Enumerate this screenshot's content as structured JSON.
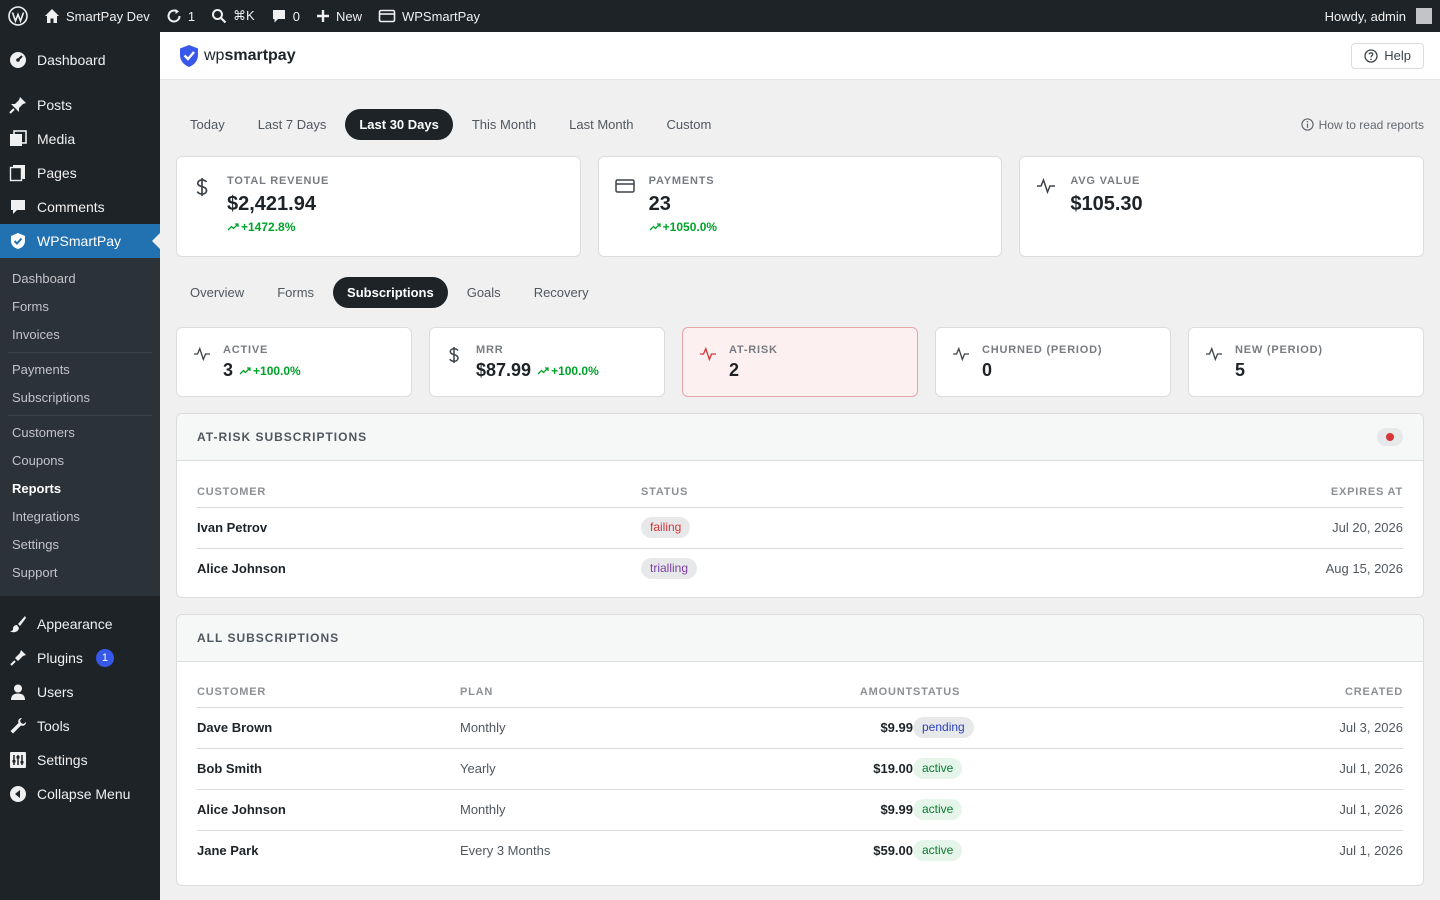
{
  "admin_bar": {
    "site_name": "SmartPay Dev",
    "updates_count": "1",
    "search_shortcut": "⌘K",
    "comments_count": "0",
    "new_label": "New",
    "plugin_label": "WPSmartPay",
    "greeting": "Howdy, admin"
  },
  "sidebar": {
    "top_items": [
      {
        "label": "Dashboard",
        "icon": "dashboard-icon"
      }
    ],
    "content_items": [
      {
        "label": "Posts",
        "icon": "pin-icon"
      },
      {
        "label": "Media",
        "icon": "media-icon"
      },
      {
        "label": "Pages",
        "icon": "pages-icon"
      },
      {
        "label": "Comments",
        "icon": "comment-icon"
      },
      {
        "label": "WPSmartPay",
        "icon": "shield-icon"
      }
    ],
    "submenu": [
      "Dashboard",
      "Forms",
      "Invoices",
      "Payments",
      "Subscriptions",
      "Customers",
      "Coupons",
      "Reports",
      "Integrations",
      "Settings",
      "Support"
    ],
    "bottom_items": [
      {
        "label": "Appearance",
        "icon": "brush-icon"
      },
      {
        "label": "Plugins",
        "icon": "plugin-icon",
        "badge": "1"
      },
      {
        "label": "Users",
        "icon": "user-icon"
      },
      {
        "label": "Tools",
        "icon": "wrench-icon"
      },
      {
        "label": "Settings",
        "icon": "sliders-icon"
      },
      {
        "label": "Collapse Menu",
        "icon": "collapse-icon"
      }
    ]
  },
  "header": {
    "logo_wp": "wp",
    "logo_smartpay": "smartpay",
    "help_label": "Help"
  },
  "period_tabs": [
    "Today",
    "Last 7 Days",
    "Last 30 Days",
    "This Month",
    "Last Month",
    "Custom"
  ],
  "active_period": "Last 30 Days",
  "how_to_label": "How to read reports",
  "kpis": [
    {
      "label": "TOTAL REVENUE",
      "value": "$2,421.94",
      "delta": "+1472.8%",
      "icon": "dollar-icon"
    },
    {
      "label": "PAYMENTS",
      "value": "23",
      "delta": "+1050.0%",
      "icon": "card-icon"
    },
    {
      "label": "AVG VALUE",
      "value": "$105.30",
      "delta": "",
      "icon": "pulse-icon"
    }
  ],
  "section_tabs": [
    "Overview",
    "Forms",
    "Subscriptions",
    "Goals",
    "Recovery"
  ],
  "active_section": "Subscriptions",
  "stats": [
    {
      "label": "ACTIVE",
      "value": "3",
      "delta": "+100.0%",
      "icon": "pulse-icon"
    },
    {
      "label": "MRR",
      "value": "$87.99",
      "delta": "+100.0%",
      "icon": "dollar-icon"
    },
    {
      "label": "AT-RISK",
      "value": "2",
      "delta": "",
      "icon": "pulse-icon"
    },
    {
      "label": "CHURNED (PERIOD)",
      "value": "0",
      "delta": "",
      "icon": "pulse-icon"
    },
    {
      "label": "NEW (PERIOD)",
      "value": "5",
      "delta": "",
      "icon": "pulse-icon"
    }
  ],
  "at_risk": {
    "title": "AT-RISK SUBSCRIPTIONS",
    "columns": [
      "CUSTOMER",
      "STATUS",
      "EXPIRES AT"
    ],
    "rows": [
      {
        "customer": "Ivan Petrov",
        "status": "failing",
        "expires": "Jul 20, 2026"
      },
      {
        "customer": "Alice Johnson",
        "status": "trialling",
        "expires": "Aug 15, 2026"
      }
    ]
  },
  "all_subs": {
    "title": "ALL SUBSCRIPTIONS",
    "columns": [
      "CUSTOMER",
      "PLAN",
      "AMOUNT",
      "STATUS",
      "CREATED"
    ],
    "rows": [
      {
        "customer": "Dave Brown",
        "plan": "Monthly",
        "amount": "$9.99",
        "status": "pending",
        "created": "Jul 3, 2026"
      },
      {
        "customer": "Bob Smith",
        "plan": "Yearly",
        "amount": "$19.00",
        "status": "active",
        "created": "Jul 1, 2026"
      },
      {
        "customer": "Alice Johnson",
        "plan": "Monthly",
        "amount": "$9.99",
        "status": "active",
        "created": "Jul 1, 2026"
      },
      {
        "customer": "Jane Park",
        "plan": "Every 3 Months",
        "amount": "$59.00",
        "status": "active",
        "created": "Jul 1, 2026"
      }
    ]
  },
  "colors": {
    "accent": "#2271b1",
    "dark": "#1d2327",
    "positive": "#00a32a",
    "danger": "#d63638"
  }
}
